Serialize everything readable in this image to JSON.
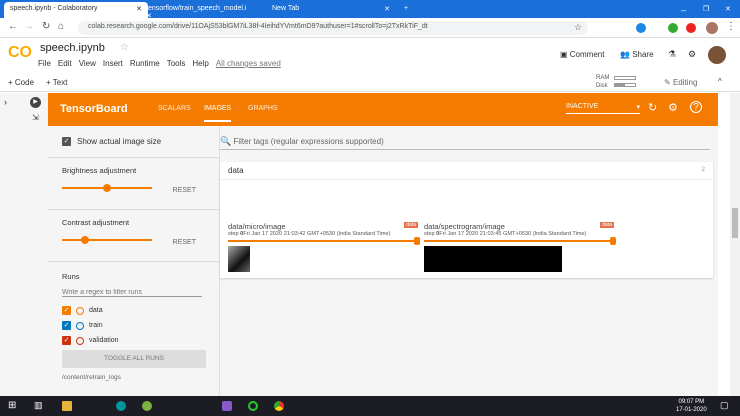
{
  "browser": {
    "tabs": [
      {
        "label": "speech.ipynb - Colaboratory"
      },
      {
        "label": "tensorflow/train_speech_model.i"
      },
      {
        "label": "New Tab"
      }
    ],
    "url": "colab.research.google.com/drive/11OAjS53blGM7iL38f-4IeihdYVmt6mD9?authuser=1#scrollTo=j2TxRkTiF_dt"
  },
  "colab": {
    "logo": "CO",
    "title": "speech.ipynb",
    "menu": [
      "File",
      "Edit",
      "View",
      "Insert",
      "Runtime",
      "Tools",
      "Help"
    ],
    "saved": "All changes saved",
    "comment": "Comment",
    "share": "Share",
    "add_code": "+ Code",
    "add_text": "+ Text",
    "ram": "RAM",
    "disk": "Disk",
    "editing": "Editing"
  },
  "tensorboard": {
    "title": "TensorBoard",
    "tabs": [
      "SCALARS",
      "IMAGES",
      "GRAPHS"
    ],
    "status": "INACTIVE",
    "show_actual": "Show actual image size",
    "brightness": "Brightness adjustment",
    "contrast": "Contrast adjustment",
    "reset": "RESET",
    "brightness_value": 0.5,
    "contrast_value": 0.25,
    "runs_label": "Runs",
    "runs_placeholder": "Write a regex to filter runs",
    "runs": [
      {
        "name": "data",
        "color": "#f57c00"
      },
      {
        "name": "train",
        "color": "#0077bb"
      },
      {
        "name": "validation",
        "color": "#cc3311"
      }
    ],
    "toggle": "TOGGLE ALL RUNS",
    "logdir": "/content/retrain_logs",
    "filter_placeholder": "Filter tags (regular expressions supported)",
    "group": "data",
    "group_count": "2",
    "cards": [
      {
        "tag": "data/micro/image",
        "badge": "data",
        "step_label": "step ",
        "step": "0",
        "time": "Fri Jan 17 2020 21:03:42 GMT+0530 (India Standard Time)"
      },
      {
        "tag": "data/spectrogram/image",
        "badge": "data",
        "step_label": "step ",
        "step": "0",
        "time": "Fri Jan 17 2020 21:03:45 GMT+0530 (India Standard Time)"
      }
    ]
  },
  "taskbar": {
    "time": "09:07 PM",
    "date": "17-01-2020"
  }
}
